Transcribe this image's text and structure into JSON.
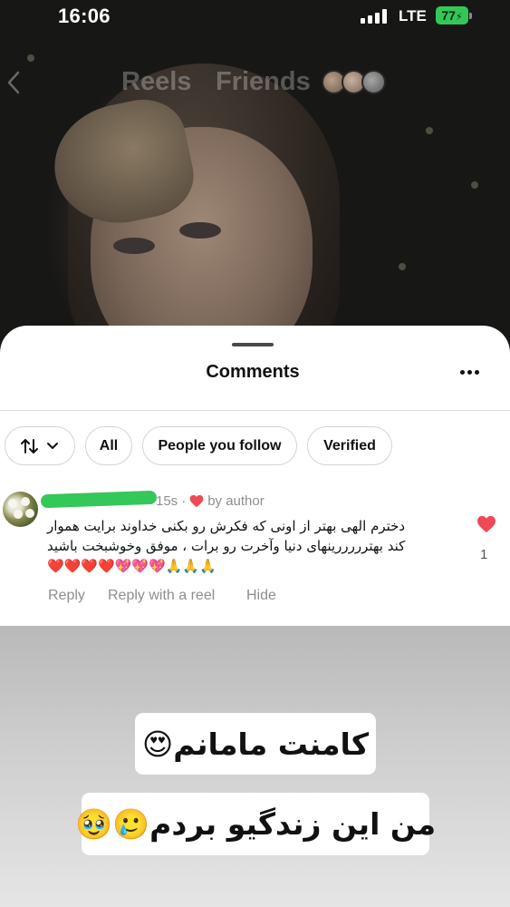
{
  "status_bar": {
    "time": "16:06",
    "network": "LTE",
    "battery": "77"
  },
  "top_nav": {
    "tabs": [
      "Reels",
      "Friends"
    ],
    "back_icon": "chevron-left-icon",
    "friend_avatar_count": 3
  },
  "comments_sheet": {
    "title": "Comments",
    "menu_icon": "ellipsis-icon",
    "filters": {
      "sort_icon": "sort-arrows-icon",
      "chevron_icon": "chevron-down-icon",
      "chips": [
        "All",
        "People you follow",
        "Verified"
      ]
    },
    "comment": {
      "username": "",
      "time": "15s",
      "separator": "·",
      "badge": "by author",
      "text": "دخترم الهی بهتر از اونی که فکرش رو بکنی خداوند برایت هموار کند بهترررررینهای دنیا وآخرت رو برات ، موفق وخوشبخت باشید🙏🙏🙏💖💖💖❤️❤️❤️❤️",
      "like_count": "1",
      "actions": [
        "Reply",
        "Reply with a reel",
        "Hide"
      ]
    }
  },
  "story_overlay": {
    "captions": [
      "کامنت مامانم😍",
      "من این زندگیو بردم🥲🥹"
    ]
  },
  "colors": {
    "accent_red": "#ed4956",
    "battery_green": "#33c759",
    "redaction_green": "#34c759",
    "muted_text": "#8e8e8e"
  }
}
